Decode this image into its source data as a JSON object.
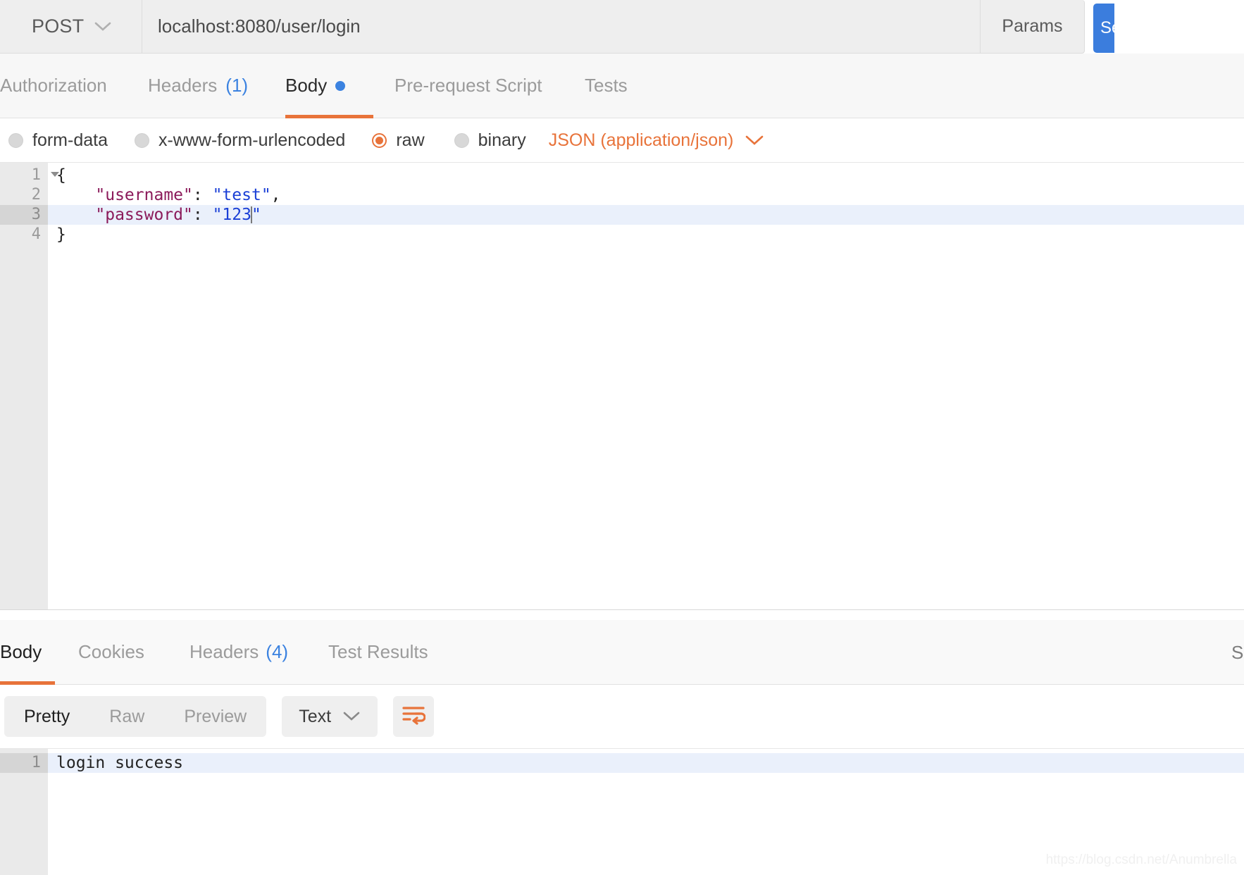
{
  "request_bar": {
    "method": "POST",
    "method_caret_icon": "chevron-down-icon",
    "url": "localhost:8080/user/login",
    "params_label": "Params",
    "send_label": "Send",
    "send_color": "#3b7ddd"
  },
  "request_tabs": [
    {
      "label": "Authorization",
      "count": "",
      "active": false
    },
    {
      "label": "Headers",
      "count": "(1)",
      "active": false
    },
    {
      "label": "Body",
      "count": "",
      "active": true,
      "dot": true
    },
    {
      "label": "Pre-request Script",
      "count": "",
      "active": false
    },
    {
      "label": "Tests",
      "count": "",
      "active": false
    }
  ],
  "body_types": [
    {
      "label": "form-data",
      "checked": false
    },
    {
      "label": "x-www-form-urlencoded",
      "checked": false
    },
    {
      "label": "raw",
      "checked": true
    },
    {
      "label": "binary",
      "checked": false
    }
  ],
  "content_type": {
    "selected": "JSON (application/json)",
    "caret_icon": "chevron-down-icon",
    "color": "#e8733a"
  },
  "request_editor": {
    "lines": [
      {
        "num": "1",
        "foldable": true,
        "active": false,
        "tokens": [
          {
            "t": "{",
            "c": "punc"
          }
        ]
      },
      {
        "num": "2",
        "foldable": false,
        "active": false,
        "tokens": [
          {
            "t": "    ",
            "c": "punc"
          },
          {
            "t": "\"username\"",
            "c": "key"
          },
          {
            "t": ": ",
            "c": "punc"
          },
          {
            "t": "\"test\"",
            "c": "str"
          },
          {
            "t": ",",
            "c": "punc"
          }
        ]
      },
      {
        "num": "3",
        "foldable": false,
        "active": true,
        "caret_after": true,
        "tokens": [
          {
            "t": "    ",
            "c": "punc"
          },
          {
            "t": "\"password\"",
            "c": "key"
          },
          {
            "t": ": ",
            "c": "punc"
          },
          {
            "t": "\"123",
            "c": "str"
          }
        ],
        "tail": "\""
      },
      {
        "num": "4",
        "foldable": false,
        "active": false,
        "tokens": [
          {
            "t": "}",
            "c": "punc"
          }
        ]
      }
    ]
  },
  "response_tabs": [
    {
      "label": "Body",
      "count": "",
      "active": true
    },
    {
      "label": "Cookies",
      "count": "",
      "active": false
    },
    {
      "label": "Headers",
      "count": "(4)",
      "active": false
    },
    {
      "label": "Test Results",
      "count": "",
      "active": false
    }
  ],
  "response_status_cut": "S",
  "response_toolbar": {
    "view_modes": [
      {
        "label": "Pretty",
        "active": true
      },
      {
        "label": "Raw",
        "active": false
      },
      {
        "label": "Preview",
        "active": false
      }
    ],
    "format": "Text",
    "format_caret_icon": "chevron-down-icon",
    "wrap_icon": "word-wrap-icon"
  },
  "response_body": {
    "lines": [
      {
        "num": "1",
        "text": "login success",
        "active": true
      }
    ]
  },
  "watermark": "https://blog.csdn.net/Anumbrella",
  "accent": {
    "orange": "#e8733a",
    "blue": "#3b82e0"
  }
}
